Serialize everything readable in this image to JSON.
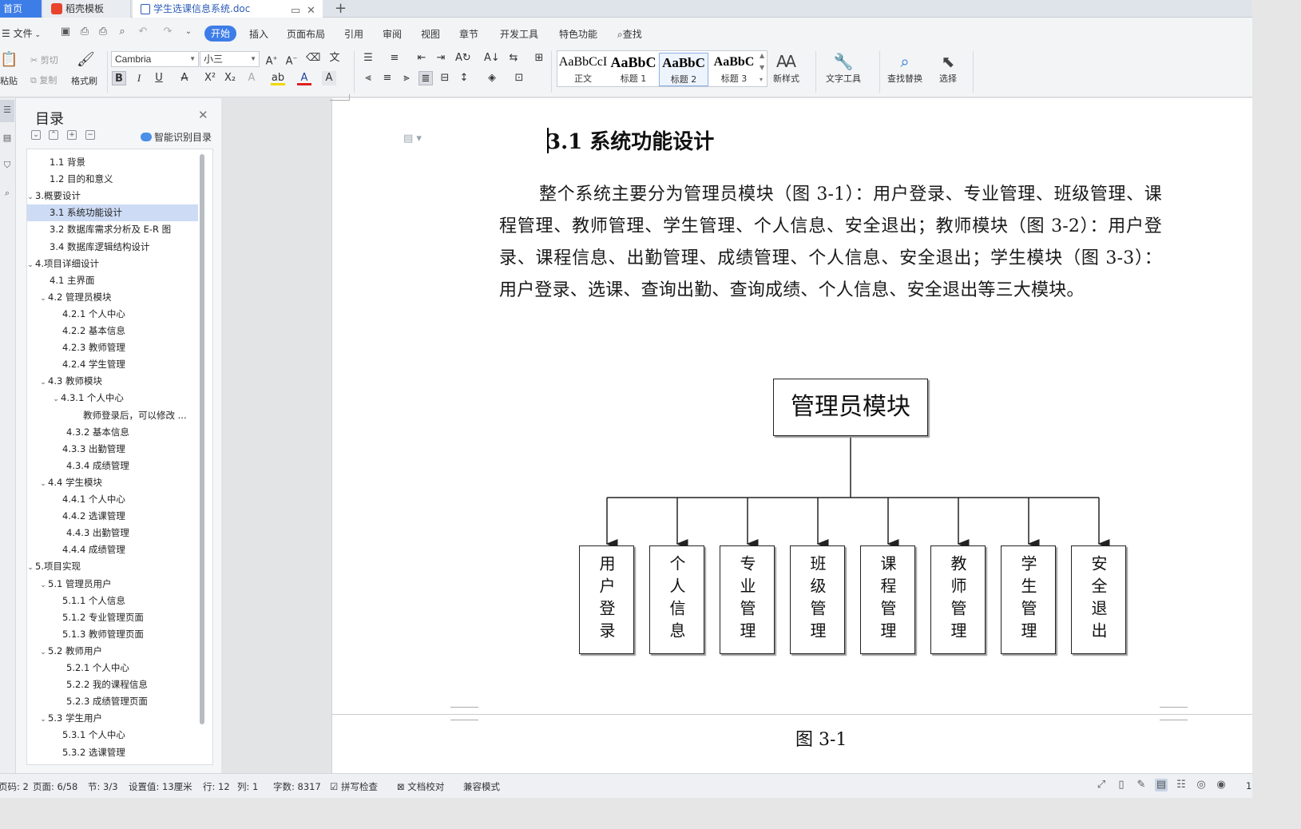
{
  "tabs": {
    "home": "首页",
    "templates": "稻壳模板",
    "document": "学生选课信息系统.doc"
  },
  "menu": {
    "file": "文件",
    "items": [
      "开始",
      "插入",
      "页面布局",
      "引用",
      "审阅",
      "视图",
      "章节",
      "开发工具",
      "特色功能"
    ],
    "search": "查找"
  },
  "ribbon": {
    "paste": "粘贴",
    "cut": "剪切",
    "copy": "复制",
    "format_painter": "格式刷",
    "font_name": "Cambria",
    "font_size": "小三",
    "styles": [
      {
        "preview": "AaBbCcI",
        "label": "正文"
      },
      {
        "preview": "AaBbC",
        "label": "标题 1"
      },
      {
        "preview": "AaBbC",
        "label": "标题 2"
      },
      {
        "preview": "AaBbC",
        "label": "标题 3"
      }
    ],
    "new_style": "新样式",
    "text_tools": "文字工具",
    "find_replace": "查找替换",
    "select": "选择"
  },
  "toc": {
    "title": "目录",
    "smart_recognize": "智能识别目录",
    "items": [
      {
        "text": "1.1 背景",
        "level": 2,
        "arrow": ""
      },
      {
        "text": "1.2 目的和意义",
        "level": 2,
        "arrow": ""
      },
      {
        "text": "3.概要设计",
        "level": 1,
        "arrow": "v"
      },
      {
        "text": "3.1 系统功能设计",
        "level": 2,
        "arrow": "",
        "selected": true
      },
      {
        "text": "3.2 数据库需求分析及 E-R 图",
        "level": 2,
        "arrow": ""
      },
      {
        "text": "3.4 数据库逻辑结构设计",
        "level": 2,
        "arrow": ""
      },
      {
        "text": "4.项目详细设计",
        "level": 1,
        "arrow": "v"
      },
      {
        "text": "4.1 主界面",
        "level": 2,
        "arrow": ""
      },
      {
        "text": "4.2 管理员模块",
        "level": 2,
        "arrow": "v"
      },
      {
        "text": "4.2.1 个人中心",
        "level": 3,
        "arrow": ""
      },
      {
        "text": "4.2.2 基本信息",
        "level": 3,
        "arrow": ""
      },
      {
        "text": "4.2.3 教师管理",
        "level": 3,
        "arrow": ""
      },
      {
        "text": "4.2.4 学生管理",
        "level": 3,
        "arrow": ""
      },
      {
        "text": "4.3 教师模块",
        "level": 2,
        "arrow": "v"
      },
      {
        "text": "4.3.1 个人中心",
        "level": 3,
        "arrow": "v"
      },
      {
        "text": "教师登录后，可以修改 ...",
        "level": 4,
        "arrow": ""
      },
      {
        "text": "4.3.2 基本信息",
        "level": 3,
        "arrow": "",
        "extra": 5
      },
      {
        "text": "4.3.3 出勤管理",
        "level": 3,
        "arrow": ""
      },
      {
        "text": "4.3.4 成绩管理",
        "level": 3,
        "arrow": "",
        "extra": 5
      },
      {
        "text": "4.4 学生模块",
        "level": 2,
        "arrow": "v"
      },
      {
        "text": "4.4.1 个人中心",
        "level": 3,
        "arrow": ""
      },
      {
        "text": "4.4.2 选课管理",
        "level": 3,
        "arrow": ""
      },
      {
        "text": "4.4.3 出勤管理",
        "level": 3,
        "arrow": "",
        "extra": 5
      },
      {
        "text": "4.4.4 成绩管理",
        "level": 3,
        "arrow": ""
      },
      {
        "text": "5.项目实现",
        "level": 1,
        "arrow": "v"
      },
      {
        "text": "5.1 管理员用户",
        "level": 2,
        "arrow": "v"
      },
      {
        "text": "5.1.1 个人信息",
        "level": 3,
        "arrow": ""
      },
      {
        "text": "5.1.2 专业管理页面",
        "level": 3,
        "arrow": ""
      },
      {
        "text": "5.1.3 教师管理页面",
        "level": 3,
        "arrow": ""
      },
      {
        "text": "5.2 教师用户",
        "level": 2,
        "arrow": "v"
      },
      {
        "text": "5.2.1 个人中心",
        "level": 3,
        "arrow": "",
        "extra": 5
      },
      {
        "text": "5.2.2 我的课程信息",
        "level": 3,
        "arrow": "",
        "extra": 5
      },
      {
        "text": "5.2.3 成绩管理页面",
        "level": 3,
        "arrow": "",
        "extra": 5
      },
      {
        "text": "5.3 学生用户",
        "level": 2,
        "arrow": "v"
      },
      {
        "text": "5.3.1 个人中心",
        "level": 3,
        "arrow": ""
      },
      {
        "text": "5.3.2 选课管理",
        "level": 3,
        "arrow": ""
      }
    ]
  },
  "document": {
    "heading": "3.1 系统功能设计",
    "paragraph": "整个系统主要分为管理员模块（图 3-1）：用户登录、专业管理、班级管理、课程管理、教师管理、学生管理、个人信息、安全退出；教师模块（图 3-2）：用户登录、课程信息、出勤管理、成绩管理、个人信息、安全退出；学生模块（图 3-3）：用户登录、选课、查询出勤、查询成绩、个人信息、安全退出等三大模块。",
    "diagram": {
      "root": "管理员模块",
      "children": [
        "用户登录",
        "个人信息",
        "专业管理",
        "班级管理",
        "课程管理",
        "教师管理",
        "学生管理",
        "安全退出"
      ]
    },
    "caption": "图 3-1"
  },
  "status": {
    "page_code": "页码: 2",
    "page": "页面: 6/58",
    "section": "节: 3/3",
    "setting": "设置值: 13厘米",
    "row": "行: 12",
    "col": "列: 1",
    "word_count": "字数: 8317",
    "spell_check": "拼写检查",
    "doc_proof": "文档校对",
    "compat_mode": "兼容模式",
    "zoom_partial": "1"
  },
  "colors": {
    "accent": "#3d7de8",
    "toc_selected": "#cddbf5"
  }
}
